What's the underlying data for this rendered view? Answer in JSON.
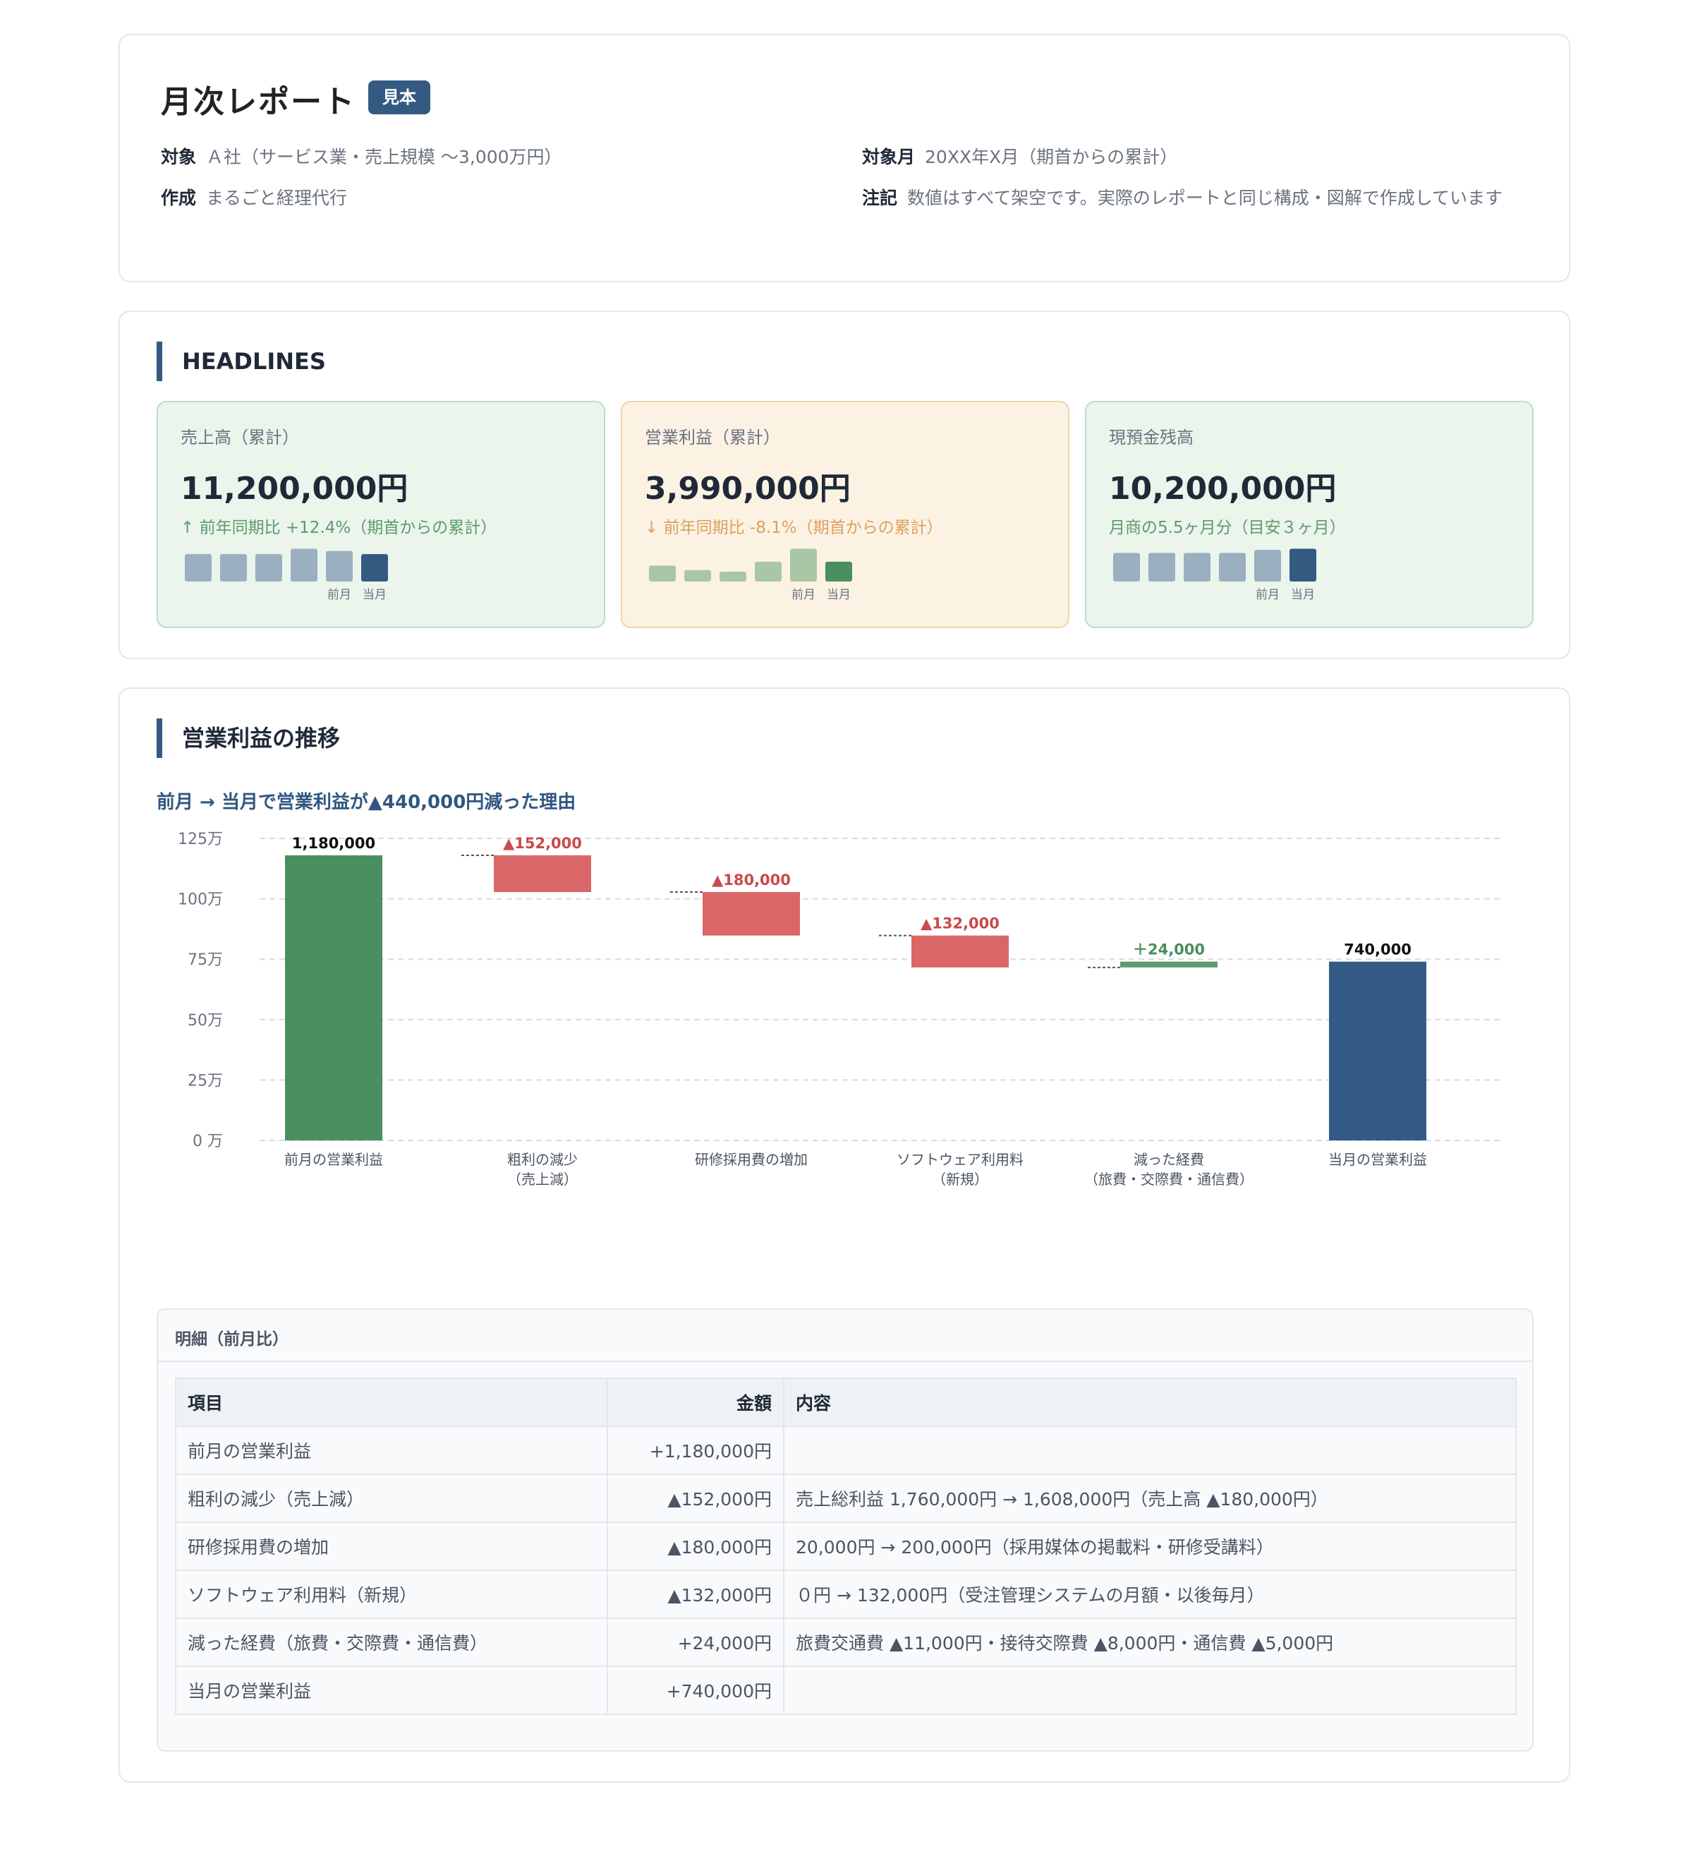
{
  "header": {
    "title": "月次レポート",
    "badge": "見本",
    "meta": [
      {
        "label": "対象",
        "value": "Ａ社（サービス業・売上規模 〜3,000万円）"
      },
      {
        "label": "作成",
        "value": "まるごと経理代行"
      },
      {
        "label": "対象月",
        "value": "20XX年X月（期首からの累計）"
      },
      {
        "label": "注記",
        "value": "数値はすべて架空です。実際のレポートと同じ構成・図解で作成しています"
      }
    ]
  },
  "headlines": {
    "title": "HEADLINES",
    "cards": [
      {
        "label": "売上高（累計）",
        "value": "11,200,000円",
        "arrow": "↑",
        "sub": "前年同期比 +12.4%（期首からの累計）",
        "theme": "green",
        "bars": [
          0.72,
          0.72,
          0.72,
          0.86,
          0.8,
          0.72
        ],
        "bar_color": "#9aafbf",
        "current_color": "#355a82"
      },
      {
        "label": "営業利益（累計）",
        "value": "3,990,000円",
        "arrow": "↓",
        "sub": "前年同期比 -8.1%（期首からの累計）",
        "theme": "orange",
        "bars": [
          0.42,
          0.3,
          0.26,
          0.52,
          0.86,
          0.52
        ],
        "bar_color": "#aac7a5",
        "current_color": "#4a8f5f"
      },
      {
        "label": "現預金残高",
        "value": "10,200,000円",
        "arrow": "",
        "sub": "月商の5.5ヶ月分（目安３ヶ月）",
        "theme": "green",
        "bars": [
          0.75,
          0.75,
          0.75,
          0.75,
          0.83,
          0.86
        ],
        "bar_color": "#9aafbf",
        "current_color": "#355a82"
      }
    ],
    "prev_label": "前月",
    "curr_label": "当月"
  },
  "chart": {
    "title": "営業利益の推移",
    "subtitle": "前月 → 当月で営業利益が▲440,000円減った理由",
    "chart_data": {
      "type": "bar",
      "variant": "waterfall",
      "ylim": [
        0,
        1250000
      ],
      "yticks": [
        0,
        250000,
        500000,
        750000,
        1000000,
        1250000
      ],
      "ytick_labels": [
        "0 万",
        "25万",
        "50万",
        "75万",
        "100万",
        "125万"
      ],
      "grid": true,
      "categories": [
        [
          "前月の営業利益"
        ],
        [
          "粗利の減少",
          "（売上減）"
        ],
        [
          "研修採用費の増加"
        ],
        [
          "ソフトウェア利用料",
          "（新規）"
        ],
        [
          "減った経費",
          "（旅費・交際費・通信費）"
        ],
        [
          "当月の営業利益"
        ]
      ],
      "values": [
        1180000,
        -152000,
        -180000,
        -132000,
        24000,
        740000
      ],
      "kinds": [
        "total",
        "delta",
        "delta",
        "delta",
        "delta",
        "total"
      ],
      "value_labels": [
        "1,180,000",
        "▲152,000",
        "▲180,000",
        "▲132,000",
        "＋24,000",
        "740,000"
      ],
      "colors": {
        "start": "#4a8f5f",
        "decrease": "#d96767",
        "increase": "#5c9a6d",
        "end": "#335b86"
      }
    }
  },
  "detail": {
    "title": "明細（前月比）",
    "headers": [
      "項目",
      "金額",
      "内容"
    ],
    "rows": [
      [
        "前月の営業利益",
        "+1,180,000円",
        ""
      ],
      [
        "粗利の減少（売上減）",
        "▲152,000円",
        "売上総利益 1,760,000円 → 1,608,000円（売上高 ▲180,000円）"
      ],
      [
        "研修採用費の増加",
        "▲180,000円",
        "20,000円 → 200,000円（採用媒体の掲載料・研修受講料）"
      ],
      [
        "ソフトウェア利用料（新規）",
        "▲132,000円",
        "０円 → 132,000円（受注管理システムの月額・以後毎月）"
      ],
      [
        "減った経費（旅費・交際費・通信費）",
        "+24,000円",
        "旅費交通費 ▲11,000円・接待交際費 ▲8,000円・通信費 ▲5,000円"
      ],
      [
        "当月の営業利益",
        "+740,000円",
        ""
      ]
    ]
  }
}
